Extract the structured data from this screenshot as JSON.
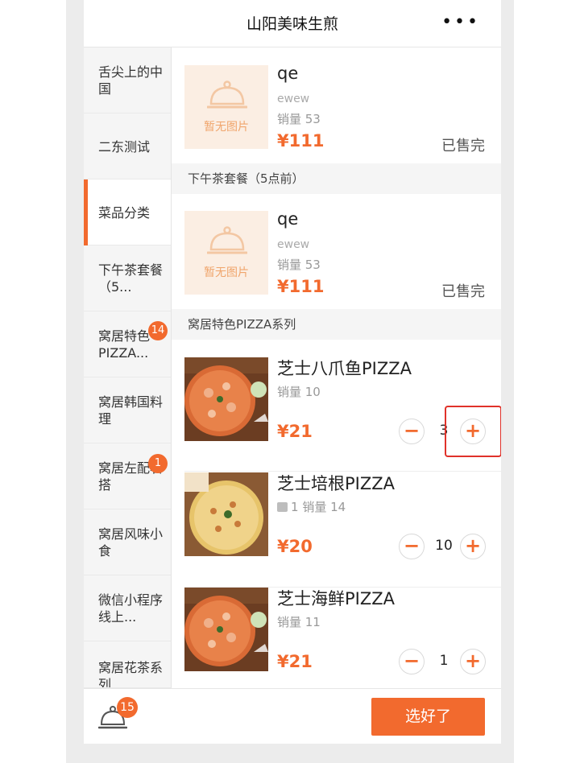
{
  "header": {
    "title": "山阳美味生煎",
    "more_icon": "more-dots-icon",
    "more_label": "•••"
  },
  "categories": [
    {
      "label": "舌尖上的中国",
      "badge": ""
    },
    {
      "label": "二东测试",
      "badge": ""
    },
    {
      "label": "菜品分类",
      "badge": "",
      "active": true
    },
    {
      "label": "下午茶套餐（5...",
      "badge": ""
    },
    {
      "label": "窝居特色PIZZA...",
      "badge": "14"
    },
    {
      "label": "窝居韩国料理",
      "badge": ""
    },
    {
      "label": "窝居左配右搭",
      "badge": "1"
    },
    {
      "label": "窝居风味小食",
      "badge": ""
    },
    {
      "label": "微信小程序线上...",
      "badge": ""
    },
    {
      "label": "窝居花茶系列",
      "badge": ""
    }
  ],
  "sections": {
    "afternoon_tea": "下午茶套餐（5点前）",
    "pizza_series": "窝居特色PIZZA系列"
  },
  "products": [
    {
      "name": "qe",
      "desc": "ewew",
      "sales": "销量 53",
      "price": "¥111",
      "status": "已售完",
      "no_image": "暂无图片"
    },
    {
      "name": "qe",
      "desc": "ewew",
      "sales": "销量 53",
      "price": "¥111",
      "status": "已售完",
      "no_image": "暂无图片"
    },
    {
      "name": "芝士八爪鱼PIZZA",
      "sales": "销量 10",
      "price": "¥21",
      "qty": "3",
      "minus": "−",
      "plus": "+"
    },
    {
      "name": "芝士培根PIZZA",
      "likes": "1",
      "sales": "销量 14",
      "price": "¥20",
      "qty": "10",
      "minus": "−",
      "plus": "+"
    },
    {
      "name": "芝士海鲜PIZZA",
      "sales": "销量 11",
      "price": "¥21",
      "qty": "1",
      "minus": "−",
      "plus": "+"
    }
  ],
  "bottom": {
    "cart_icon": "cloche-cart-icon",
    "cart_count": "15",
    "confirm_label": "选好了"
  },
  "colors": {
    "accent": "#f26a2e",
    "highlight": "#e0322a"
  }
}
